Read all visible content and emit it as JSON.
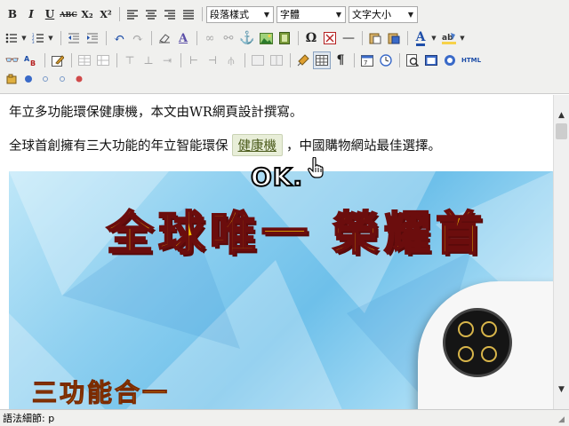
{
  "toolbar": {
    "format_select": "段落樣式",
    "font_select": "字體",
    "size_select": "文字大小",
    "row1": {
      "bold": "B",
      "italic": "I",
      "underline": "U",
      "strike": "ABC",
      "subscript": "X₂",
      "superscript": "X²"
    },
    "row2": {
      "omega": "Ω",
      "text_color": "A",
      "hr": "—"
    },
    "row3": {
      "pilcrow": "¶",
      "html": "HTML"
    }
  },
  "editor": {
    "paragraph_1": "年立多功能環保健康機，本文由WR網頁設計撰寫。",
    "paragraph_2_before": "全球首創擁有三大功能的年立智能環保",
    "paragraph_2_link": "健康機",
    "paragraph_2_after": "，中國購物網站最佳選擇。",
    "overlay_ok": "OK.",
    "banner": {
      "title_part1": "全球唯一",
      "title_part2": "榮耀首",
      "subtitle": "三功能合一"
    }
  },
  "statusbar": {
    "path": "語法細節: p"
  }
}
